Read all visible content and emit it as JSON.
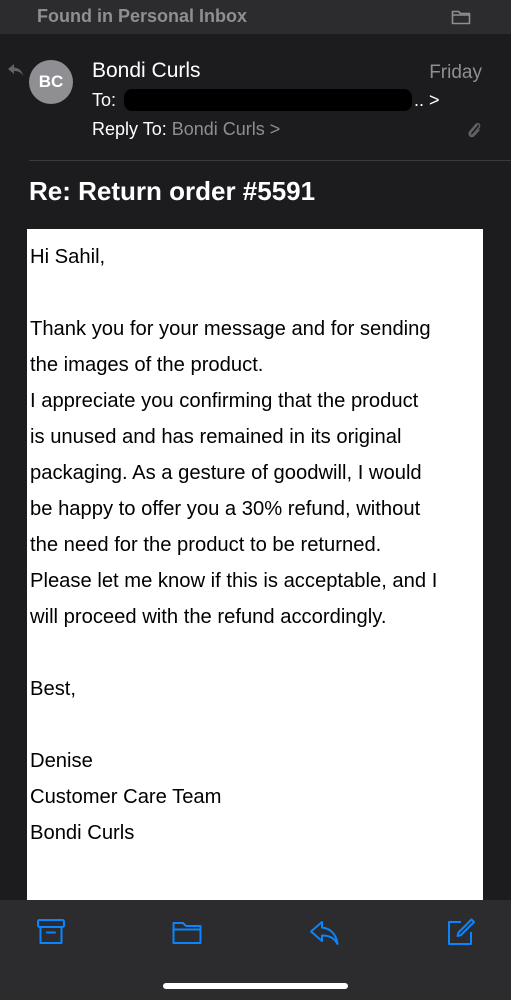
{
  "banner": {
    "text": "Found in Personal Inbox"
  },
  "header": {
    "avatar_initials": "BC",
    "sender": "Bondi Curls",
    "date": "Friday",
    "to_label": "To:",
    "to_tail": ".. >",
    "reply_to_label": "Reply To:",
    "reply_to_name": "Bondi Curls >"
  },
  "subject": "Re: Return order #5591",
  "body": {
    "lines": [
      "Hi Sahil,",
      "",
      "Thank you for your message and for sending",
      "the images of the product.",
      "I appreciate you confirming that the product",
      "is unused and has remained in its original",
      "packaging. As a gesture of goodwill, I would",
      "be happy to offer you a 30% refund, without",
      "the need for the product to be returned.",
      "Please let me know if this is acceptable, and I",
      "will proceed with the refund accordingly.",
      "",
      "Best,",
      "",
      "Denise",
      "Customer Care Team",
      "Bondi Curls"
    ]
  },
  "colors": {
    "accent": "#0a84ff",
    "background": "#1c1c1e",
    "toolbar": "#2c2c2e",
    "secondary_text": "#8e8e93"
  },
  "toolbar": {
    "icons": [
      "archive-icon",
      "folder-icon",
      "reply-icon",
      "compose-icon"
    ]
  }
}
